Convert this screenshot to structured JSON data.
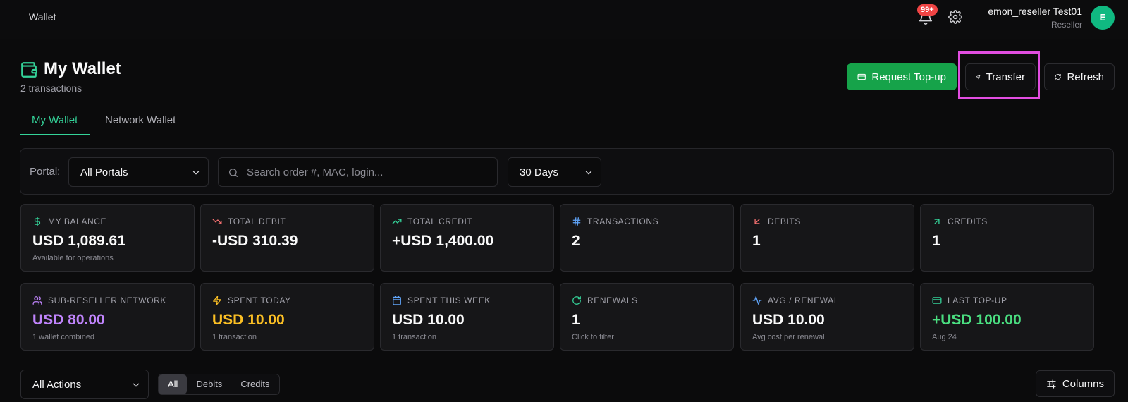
{
  "topbar": {
    "title": "Wallet",
    "notifications_badge": "99+",
    "user_name": "emon_reseller Test01",
    "user_role": "Reseller",
    "avatar_initial": "E"
  },
  "header": {
    "title": "My Wallet",
    "subtitle": "2 transactions",
    "request_topup_label": "Request Top-up",
    "transfer_label": "Transfer",
    "refresh_label": "Refresh"
  },
  "tabs": [
    {
      "label": "My Wallet",
      "active": true
    },
    {
      "label": "Network Wallet",
      "active": false
    }
  ],
  "filters": {
    "portal_label": "Portal:",
    "portal_value": "All Portals",
    "search_placeholder": "Search order #, MAC, login...",
    "range_value": "30 Days"
  },
  "cards": [
    {
      "label": "MY BALANCE",
      "value": "USD 1,089.61",
      "sub": "Available for operations",
      "icon": "dollar-icon",
      "icon_color": "#34d399",
      "value_color": "#fafafa"
    },
    {
      "label": "TOTAL DEBIT",
      "value": "-USD 310.39",
      "sub": "",
      "icon": "trending-down-icon",
      "icon_color": "#f87171",
      "value_color": "#fafafa"
    },
    {
      "label": "TOTAL CREDIT",
      "value": "+USD 1,400.00",
      "sub": "",
      "icon": "trending-up-icon",
      "icon_color": "#34d399",
      "value_color": "#fafafa"
    },
    {
      "label": "TRANSACTIONS",
      "value": "2",
      "sub": "",
      "icon": "hash-icon",
      "icon_color": "#60a5fa",
      "value_color": "#fafafa"
    },
    {
      "label": "DEBITS",
      "value": "1",
      "sub": "",
      "icon": "arrow-down-left-icon",
      "icon_color": "#f87171",
      "value_color": "#fafafa"
    },
    {
      "label": "CREDITS",
      "value": "1",
      "sub": "",
      "icon": "arrow-up-right-icon",
      "icon_color": "#34d399",
      "value_color": "#fafafa"
    },
    {
      "label": "SUB-RESELLER NETWORK",
      "value": "USD 80.00",
      "sub": "1 wallet combined",
      "icon": "users-icon",
      "icon_color": "#c084fc",
      "value_color": "#c084fc"
    },
    {
      "label": "SPENT TODAY",
      "value": "USD 10.00",
      "sub": "1 transaction",
      "icon": "bolt-icon",
      "icon_color": "#fbbf24",
      "value_color": "#fbbf24"
    },
    {
      "label": "SPENT THIS WEEK",
      "value": "USD 10.00",
      "sub": "1 transaction",
      "icon": "calendar-icon",
      "icon_color": "#60a5fa",
      "value_color": "#fafafa"
    },
    {
      "label": "RENEWALS",
      "value": "1",
      "sub": "Click to filter",
      "icon": "refresh-icon",
      "icon_color": "#34d399",
      "value_color": "#fafafa"
    },
    {
      "label": "AVG / RENEWAL",
      "value": "USD 10.00",
      "sub": "Avg cost per renewal",
      "icon": "activity-icon",
      "icon_color": "#60a5fa",
      "value_color": "#fafafa"
    },
    {
      "label": "LAST TOP-UP",
      "value": "+USD 100.00",
      "sub": "Aug 24",
      "icon": "card-icon",
      "icon_color": "#34d399",
      "value_color": "#4ade80"
    }
  ],
  "toolbar": {
    "actions_value": "All Actions",
    "segments": [
      {
        "label": "All",
        "active": true
      },
      {
        "label": "Debits",
        "active": false
      },
      {
        "label": "Credits",
        "active": false
      }
    ],
    "columns_label": "Columns"
  }
}
